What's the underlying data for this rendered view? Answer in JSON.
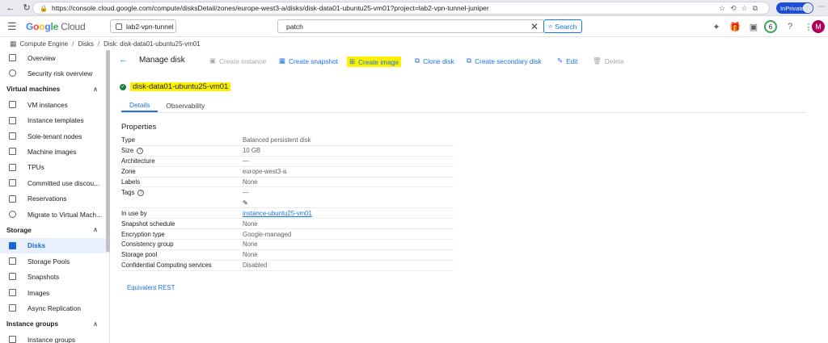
{
  "browser": {
    "url": "https://console.cloud.google.com/compute/disksDetail/zones/europe-west3-a/disks/disk-data01-ubuntu25-vm01?project=lab2-vpn-tunnel-juniper",
    "inprivate_label": "InPrivate"
  },
  "header": {
    "brand_google": "Google",
    "brand_cloud": "Cloud",
    "project": "lab2-vpn-tunnel",
    "search_value": "patch",
    "search_button": "Search",
    "notification_count": "6",
    "avatar_letter": "M"
  },
  "breadcrumb": [
    "Compute Engine",
    "Disks",
    "Disk: disk-data01-ubuntu25-vm01"
  ],
  "sidebar": {
    "top_items": [
      "Overview",
      "Security risk overview"
    ],
    "sections": [
      {
        "title": "Virtual machines",
        "items": [
          "VM instances",
          "Instance templates",
          "Sole-tenant nodes",
          "Machine images",
          "TPUs",
          "Committed use discou...",
          "Reservations",
          "Migrate to Virtual Mach..."
        ]
      },
      {
        "title": "Storage",
        "items": [
          "Disks",
          "Storage Pools",
          "Snapshots",
          "Images",
          "Async Replication"
        ]
      },
      {
        "title": "Instance groups",
        "items": [
          "Instance groups"
        ]
      }
    ]
  },
  "toolbar": {
    "title": "Manage disk",
    "create_instance": "Create instance",
    "create_snapshot": "Create snapshot",
    "create_image": "Create image",
    "clone_disk": "Clone disk",
    "create_secondary": "Create secondary disk",
    "edit": "Edit",
    "delete": "Delete"
  },
  "disk": {
    "name": "disk-data01-ubuntu25-vm01",
    "tabs": [
      "Details",
      "Observability"
    ]
  },
  "properties": {
    "title": "Properties",
    "rows": {
      "type": {
        "k": "Type",
        "v": "Balanced persistent disk"
      },
      "size": {
        "k": "Size",
        "v": "10 GB"
      },
      "architecture": {
        "k": "Architecture",
        "v": "—"
      },
      "zone": {
        "k": "Zone",
        "v": "europe-west3-a"
      },
      "labels": {
        "k": "Labels",
        "v": "None"
      },
      "tags": {
        "k": "Tags",
        "v": "—"
      },
      "in_use_by": {
        "k": "In use by",
        "v": "instance-ubuntu25-vm01"
      },
      "snapshot_schedule": {
        "k": "Snapshot schedule",
        "v": "None"
      },
      "encryption": {
        "k": "Encryption type",
        "v": "Google-managed"
      },
      "consistency": {
        "k": "Consistency group",
        "v": "None"
      },
      "storage_pool": {
        "k": "Storage pool",
        "v": "None"
      },
      "confidential": {
        "k": "Confidential Computing services",
        "v": "Disabled"
      }
    },
    "equivalent_rest": "Equivalent REST"
  }
}
